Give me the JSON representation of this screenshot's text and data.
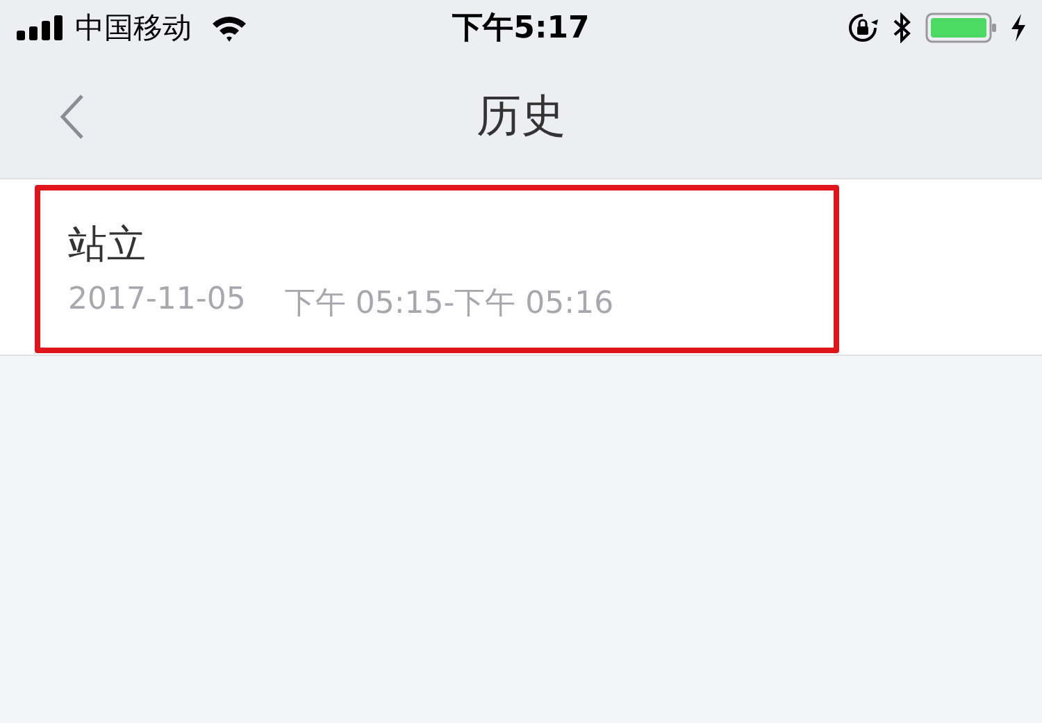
{
  "status_bar": {
    "carrier": "中国移动",
    "time": "下午5:17"
  },
  "nav": {
    "title": "历史"
  },
  "history": [
    {
      "name": "站立",
      "date": "2017-11-05",
      "time_range": "下午 05:15-下午 05:16",
      "highlighted": true
    }
  ]
}
